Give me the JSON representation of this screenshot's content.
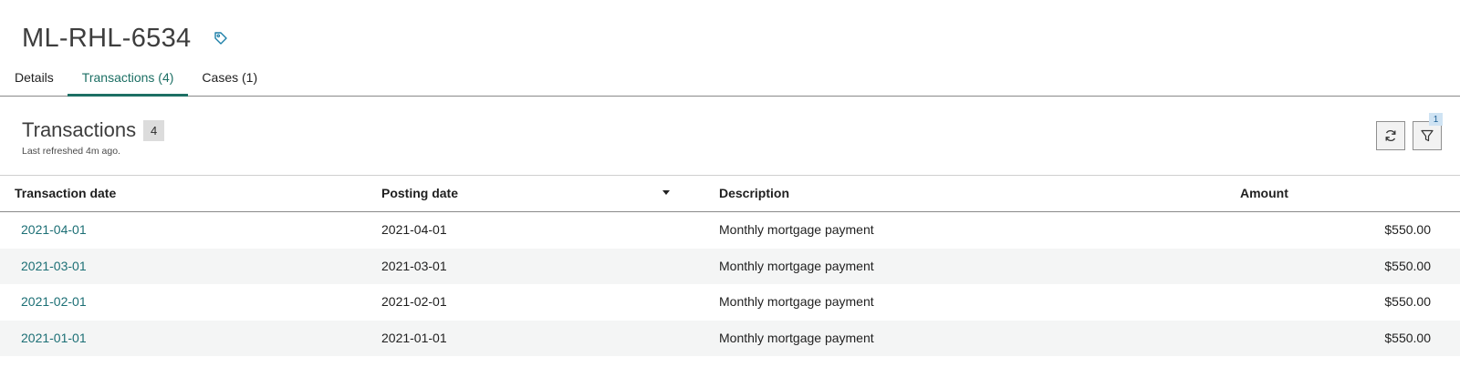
{
  "header": {
    "title": "ML-RHL-6534",
    "tag_icon": "tag-icon"
  },
  "tabs": [
    {
      "label": "Details",
      "active": false
    },
    {
      "label": "Transactions (4)",
      "active": true
    },
    {
      "label": "Cases (1)",
      "active": false
    }
  ],
  "section": {
    "title": "Transactions",
    "count": "4",
    "refreshed": "Last refreshed 4m ago."
  },
  "toolbar": {
    "refresh_icon": "refresh-icon",
    "filter_icon": "filter-icon",
    "filter_badge": "1"
  },
  "table": {
    "columns": [
      "Transaction date",
      "Posting date",
      "Description",
      "Amount"
    ],
    "sorted_column": "Posting date",
    "rows": [
      {
        "transaction_date": "2021-04-01",
        "posting_date": "2021-04-01",
        "description": "Monthly mortgage payment",
        "amount": "$550.00"
      },
      {
        "transaction_date": "2021-03-01",
        "posting_date": "2021-03-01",
        "description": "Monthly mortgage payment",
        "amount": "$550.00"
      },
      {
        "transaction_date": "2021-02-01",
        "posting_date": "2021-02-01",
        "description": "Monthly mortgage payment",
        "amount": "$550.00"
      },
      {
        "transaction_date": "2021-01-01",
        "posting_date": "2021-01-01",
        "description": "Monthly mortgage payment",
        "amount": "$550.00"
      }
    ]
  },
  "colors": {
    "accent": "#1c6f64",
    "link": "#1c6f75",
    "row_alt": "#f4f5f5"
  }
}
